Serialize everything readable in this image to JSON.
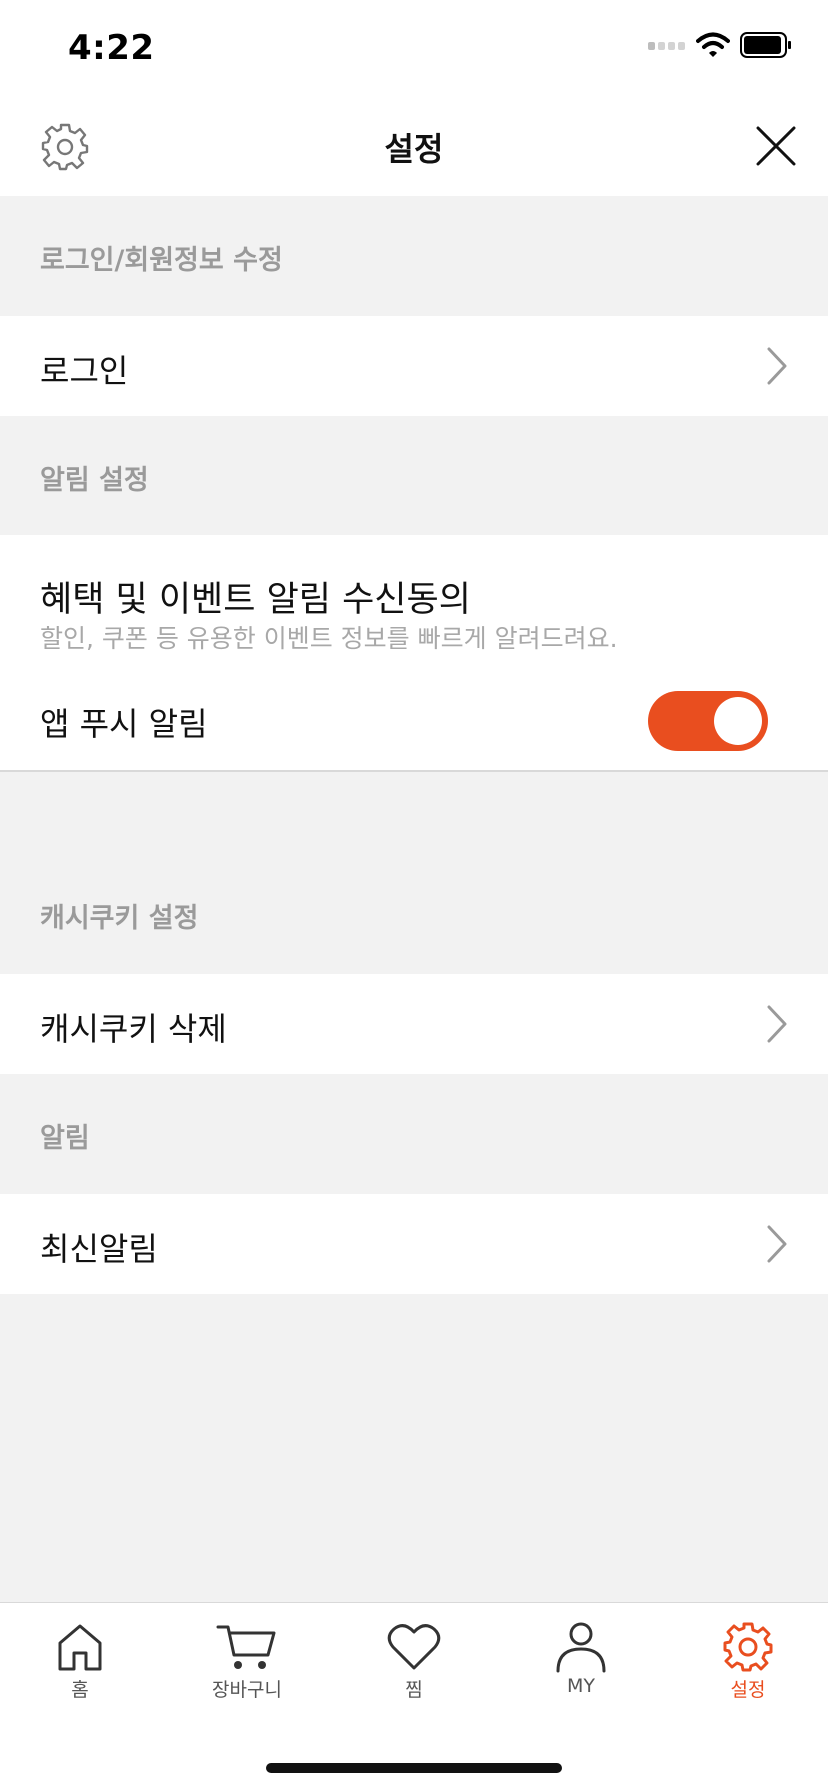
{
  "status_bar": {
    "time": "4:22"
  },
  "header": {
    "title": "설정"
  },
  "sections": {
    "login_header": "로그인/회원정보 수정",
    "login_row": "로그인",
    "notify_header": "알림 설정",
    "benefit_title": "혜택 및 이벤트 알림 수신동의",
    "benefit_desc": "할인, 쿠폰 등 유용한 이벤트 정보를 빠르게 알려드려요.",
    "push_label": "앱 푸시 알림",
    "push_enabled": true,
    "cashcookie_header": "캐시쿠키 설정",
    "cashcookie_row": "캐시쿠키 삭제",
    "alarm_header": "알림",
    "alarm_row": "최신알림"
  },
  "tab_bar": {
    "tabs": [
      {
        "label": "홈",
        "icon": "home-icon"
      },
      {
        "label": "장바구니",
        "icon": "cart-icon"
      },
      {
        "label": "찜",
        "icon": "heart-icon"
      },
      {
        "label": "MY",
        "icon": "person-icon"
      },
      {
        "label": "설정",
        "icon": "gear-icon",
        "active": true
      }
    ]
  },
  "colors": {
    "accent": "#e94e1f",
    "section_text": "#9a9a9a",
    "icon_gray": "#333333"
  }
}
